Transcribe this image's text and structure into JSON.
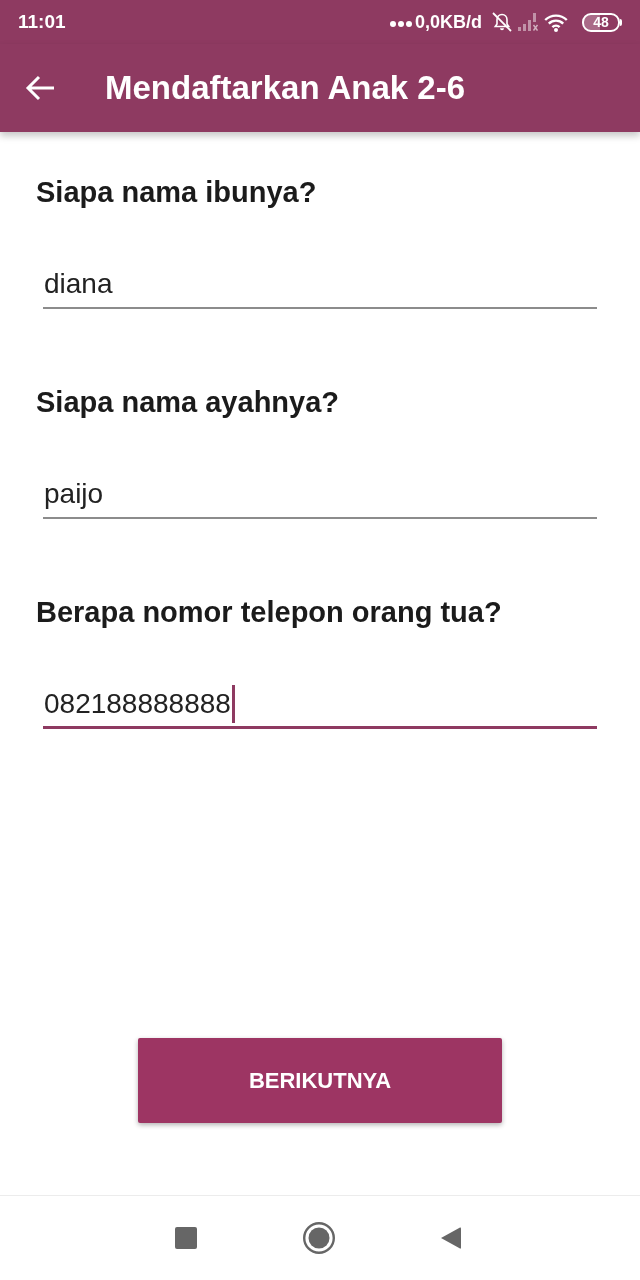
{
  "status_bar": {
    "time": "11:01",
    "data_speed": "0,0KB/d",
    "battery": "48"
  },
  "app_bar": {
    "title": "Mendaftarkan Anak 2-6"
  },
  "fields": [
    {
      "label": "Siapa nama ibunya?",
      "value": "diana",
      "focused": false
    },
    {
      "label": "Siapa nama ayahnya?",
      "value": "paijo",
      "focused": false
    },
    {
      "label": "Berapa nomor telepon orang tua?",
      "value": "082188888888",
      "focused": true
    }
  ],
  "next_button": {
    "label": "BERIKUTNYA"
  }
}
